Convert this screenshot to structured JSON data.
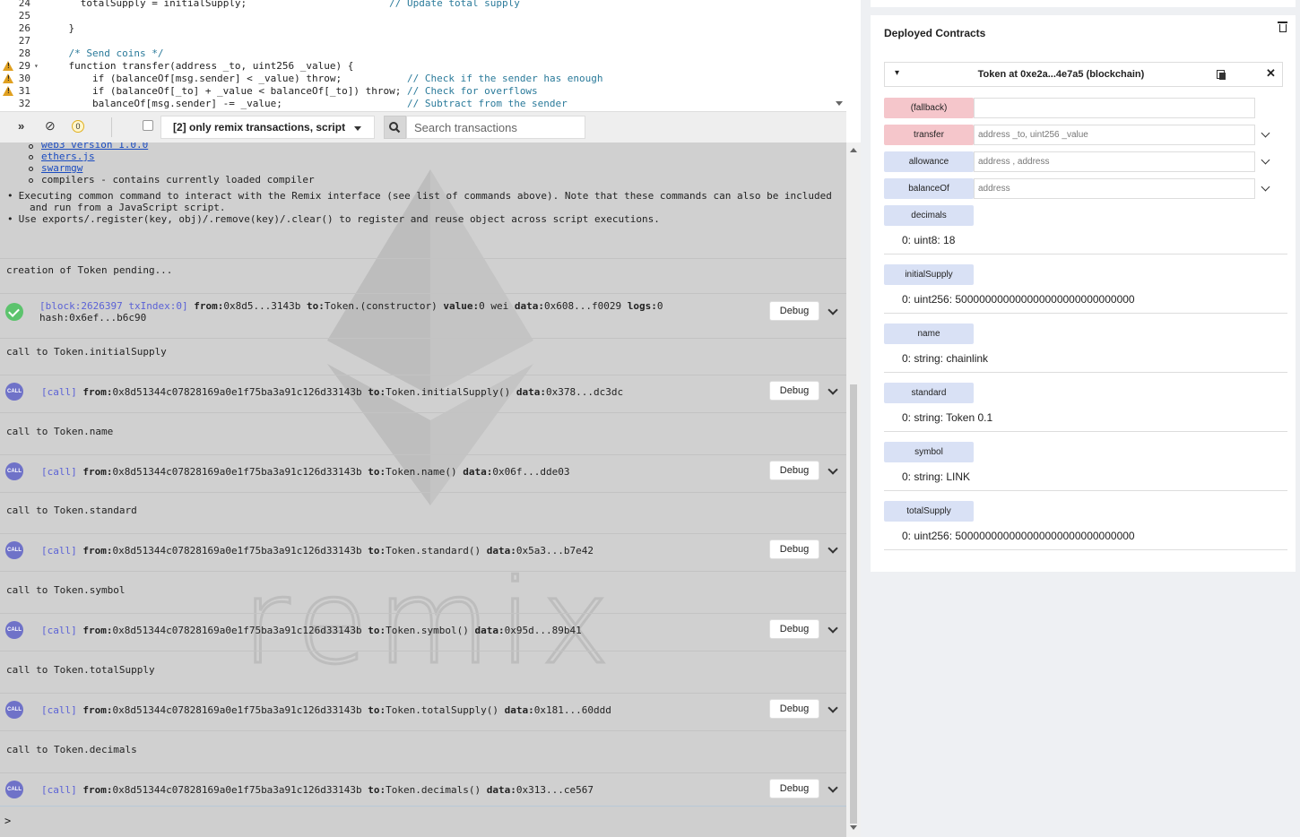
{
  "editor": {
    "lines": [
      {
        "num": "24",
        "indent": "      ",
        "text": "totalSupply = initialSupply;",
        "comment": "// Update total supply",
        "pad": "                        ",
        "warn": false
      },
      {
        "num": "25",
        "indent": "",
        "text": "",
        "comment": "",
        "pad": "",
        "warn": false
      },
      {
        "num": "26",
        "indent": "    ",
        "text": "}",
        "comment": "",
        "pad": "",
        "warn": false
      },
      {
        "num": "27",
        "indent": "",
        "text": "",
        "comment": "",
        "pad": "",
        "warn": false
      },
      {
        "num": "28",
        "indent": "    ",
        "text": "",
        "comment": "/* Send coins */",
        "pad": "",
        "warn": false
      },
      {
        "num": "29",
        "indent": "    ",
        "text": "function transfer(address _to, uint256 _value) {",
        "comment": "",
        "pad": "",
        "warn": true
      },
      {
        "num": "30",
        "indent": "        ",
        "text": "if (balanceOf[msg.sender] < _value) throw;",
        "comment": "// Check if the sender has enough",
        "pad": "           ",
        "warn": true
      },
      {
        "num": "31",
        "indent": "        ",
        "text": "if (balanceOf[_to] + _value < balanceOf[_to]) throw;",
        "comment": "// Check for overflows",
        "pad": " ",
        "warn": true
      },
      {
        "num": "32",
        "indent": "        ",
        "text": "balanceOf[msg.sender] -= _value;",
        "comment": "// Subtract from the sender",
        "pad": "                     ",
        "warn": false
      }
    ]
  },
  "terminal_bar": {
    "pending_count": "0",
    "filter_label": "[2] only remix transactions, script",
    "search_placeholder": "Search transactions"
  },
  "terminal": {
    "intro_links": [
      "web3 version 1.0.0",
      "ethers.js",
      "swarmgw"
    ],
    "intro_compilers": "compilers - contains currently loaded compiler",
    "bullet1_line1": "Executing common command to interact with the Remix interface (see list of commands above). Note that these commands can also be included",
    "bullet1_line2": "and run from a JavaScript script.",
    "bullet2": "Use exports/.register(key, obj)/.remove(key)/.clear() to register and reuse object across script executions.",
    "pending": "creation of Token pending...",
    "creation": {
      "block": "[block:2626397 txIndex:0]",
      "from_label": "from:",
      "from": "0x8d5...3143b",
      "to_label": "to:",
      "to": "Token.(constructor)",
      "value_label": "value:",
      "value": "0 wei",
      "data_label": "data:",
      "data": "0x608...f0029",
      "logs_label": "logs:",
      "logs": "0",
      "hash_label": "hash:",
      "hash": "0x6ef...b6c90"
    },
    "debug_label": "Debug",
    "calls": [
      {
        "title": "call to Token.initialSupply",
        "tag": "[call]",
        "from": "0x8d51344c07828169a0e1f75ba3a91c126d33143b",
        "to": "Token.initialSupply()",
        "data": "0x378...dc3dc"
      },
      {
        "title": "call to Token.name",
        "tag": "[call]",
        "from": "0x8d51344c07828169a0e1f75ba3a91c126d33143b",
        "to": "Token.name()",
        "data": "0x06f...dde03"
      },
      {
        "title": "call to Token.standard",
        "tag": "[call]",
        "from": "0x8d51344c07828169a0e1f75ba3a91c126d33143b",
        "to": "Token.standard()",
        "data": "0x5a3...b7e42"
      },
      {
        "title": "call to Token.symbol",
        "tag": "[call]",
        "from": "0x8d51344c07828169a0e1f75ba3a91c126d33143b",
        "to": "Token.symbol()",
        "data": "0x95d...89b41"
      },
      {
        "title": "call to Token.totalSupply",
        "tag": "[call]",
        "from": "0x8d51344c07828169a0e1f75ba3a91c126d33143b",
        "to": "Token.totalSupply()",
        "data": "0x181...60ddd"
      },
      {
        "title": "call to Token.decimals",
        "tag": "[call]",
        "from": "0x8d51344c07828169a0e1f75ba3a91c126d33143b",
        "to": "Token.decimals()",
        "data": "0x313...ce567"
      }
    ],
    "call_badge": "CALL",
    "prompt": ">",
    "watermark": "remix"
  },
  "deployed": {
    "title": "Deployed Contracts",
    "instance_title": "Token at 0xe2a...4e7a5 (blockchain)",
    "functions": [
      {
        "name": "(fallback)",
        "kind": "payable",
        "placeholder": "",
        "expandable": false
      },
      {
        "name": "transfer",
        "kind": "payable",
        "placeholder": "address _to, uint256 _value",
        "expandable": true
      },
      {
        "name": "allowance",
        "kind": "view",
        "placeholder": "address , address",
        "expandable": true
      },
      {
        "name": "balanceOf",
        "kind": "view",
        "placeholder": "address",
        "expandable": true
      }
    ],
    "getters": [
      {
        "name": "decimals",
        "result": "0: uint8: 18"
      },
      {
        "name": "initialSupply",
        "result": "0: uint256: 500000000000000000000000000000"
      },
      {
        "name": "name",
        "result": "0: string: chainlink"
      },
      {
        "name": "standard",
        "result": "0: string: Token 0.1"
      },
      {
        "name": "symbol",
        "result": "0: string: LINK"
      },
      {
        "name": "totalSupply",
        "result": "0: uint256: 500000000000000000000000000000"
      }
    ]
  },
  "colors": {
    "payable_button": "#f5c6cb",
    "view_button": "#d9e1f5",
    "call_badge": "#6f72c8",
    "success_badge": "#5cc36d"
  }
}
